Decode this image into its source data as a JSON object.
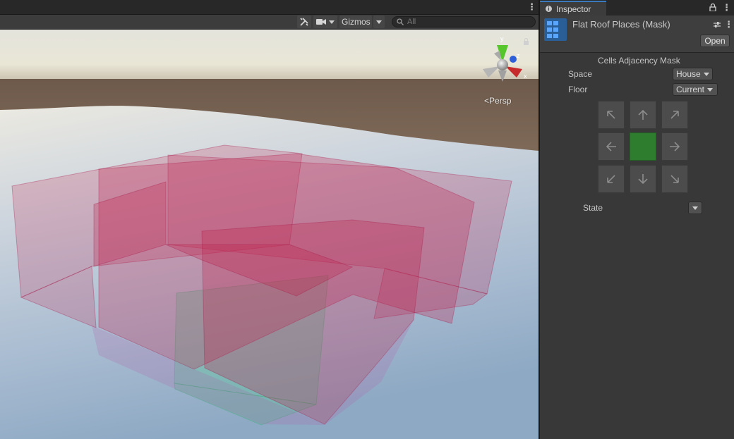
{
  "scene": {
    "gizmos_label": "Gizmos",
    "search_placeholder": "All",
    "camera_mode": "Persp",
    "axis_labels": {
      "y": "y",
      "z": "z",
      "x": "x"
    }
  },
  "inspector": {
    "tab_label": "Inspector",
    "asset_title": "Flat Roof Places (Mask)",
    "open_button": "Open",
    "section_title": "Cells Adjacency Mask",
    "space": {
      "label": "Space",
      "value": "House"
    },
    "floor": {
      "label": "Floor",
      "value": "Current"
    },
    "grid": [
      [
        "arrow-up-left-icon",
        "arrow-up-icon",
        "arrow-up-right-icon"
      ],
      [
        "arrow-left-icon",
        "center-cell",
        "arrow-right-icon"
      ],
      [
        "arrow-down-left-icon",
        "arrow-down-icon",
        "arrow-down-right-icon"
      ]
    ],
    "state": {
      "label": "State",
      "value": ""
    }
  },
  "colors": {
    "accent_blue": "#3a79bb",
    "center_cell_green": "#2e7d2e",
    "box_red": "#c2185b",
    "box_green": "#4caf7a"
  }
}
